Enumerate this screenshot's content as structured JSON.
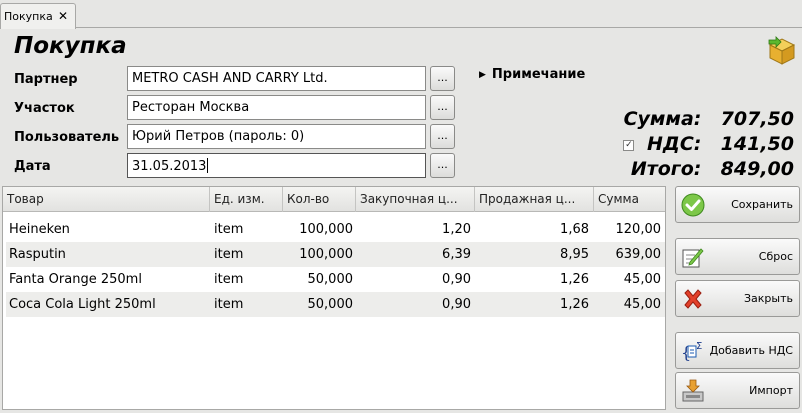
{
  "tab": {
    "label": "Покупка",
    "close": "✕"
  },
  "title": "Покупка",
  "form": {
    "partner_label": "Партнер",
    "partner_value": "METRO CASH AND CARRY Ltd.",
    "site_label": "Участок",
    "site_value": "Ресторан Москва",
    "user_label": "Пользователь",
    "user_value": "Юрий Петров (пароль: 0)",
    "date_label": "Дата",
    "date_value": "31.05.2013",
    "dots": "..."
  },
  "note": {
    "label": "Примечание"
  },
  "totals": {
    "sum_label": "Сумма:",
    "sum_value": "707,50",
    "vat_label": "НДС:",
    "vat_value": "141,50",
    "vat_checked": true,
    "total_label": "Итого:",
    "total_value": "849,00"
  },
  "table": {
    "columns": [
      "Товар",
      "Ед. изм.",
      "Кол-во",
      "Закупочная ц...",
      "Продажная ц...",
      "Сумма"
    ],
    "rows": [
      [
        "Heineken",
        "item",
        "100,000",
        "1,20",
        "1,68",
        "120,00"
      ],
      [
        "Rasputin",
        "item",
        "100,000",
        "6,39",
        "8,95",
        "639,00"
      ],
      [
        "Fanta Orange 250ml",
        "item",
        "50,000",
        "0,90",
        "1,26",
        "45,00"
      ],
      [
        "Coca Cola Light 250ml",
        "item",
        "50,000",
        "0,90",
        "1,26",
        "45,00"
      ]
    ]
  },
  "buttons": {
    "save": "Сохранить",
    "reset": "Сброс",
    "close": "Закрыть",
    "add_vat": "Добавить НДС",
    "import": "Импорт"
  },
  "colors": {
    "accent_green": "#6fbf3a",
    "close_red": "#e03020",
    "box_yellow": "#e8b830"
  },
  "icons": [
    "box-arrow-icon",
    "checkmark-icon",
    "edit-icon",
    "red-x-icon",
    "vat-formula-icon",
    "import-icon"
  ]
}
